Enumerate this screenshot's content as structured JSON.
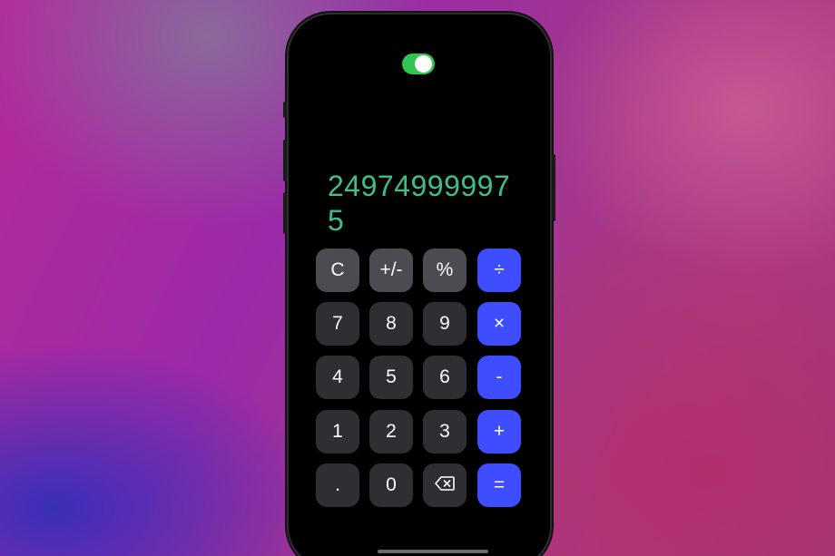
{
  "toggle": {
    "state": "on",
    "color": "#31c552"
  },
  "display": {
    "value": "249749999975",
    "color": "#3dbf85"
  },
  "keys": {
    "row1": [
      "C",
      "+/-",
      "%",
      "÷"
    ],
    "row2": [
      "7",
      "8",
      "9",
      "×"
    ],
    "row3": [
      "4",
      "5",
      "6",
      "-"
    ],
    "row4": [
      "1",
      "2",
      "3",
      "+"
    ],
    "row5": [
      ".",
      "0",
      "backspace-icon",
      "="
    ]
  },
  "colors": {
    "function_key": "#4b4b52",
    "number_key": "#2f2f33",
    "operator_key": "#3d4dff"
  }
}
